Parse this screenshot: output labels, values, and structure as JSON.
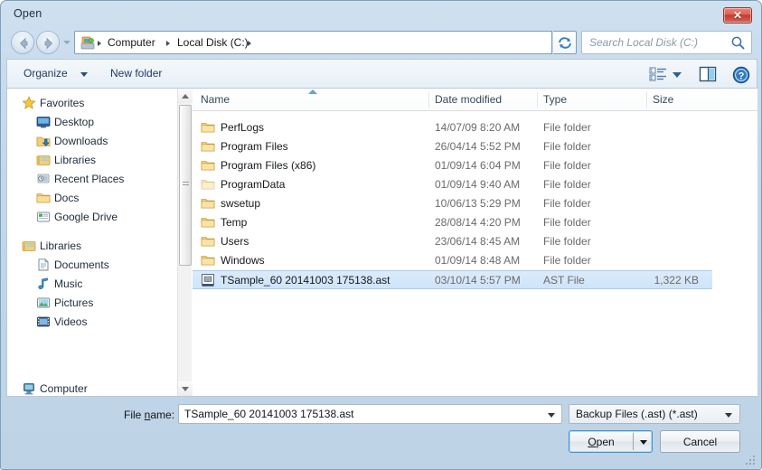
{
  "window": {
    "title": "Open",
    "close_label": "✕"
  },
  "navbar": {
    "back_icon": "back-arrow-icon",
    "forward_icon": "forward-arrow-icon",
    "history_icon": "history-dropdown-icon",
    "address_icon": "computer-icon",
    "breadcrumbs": [
      "Computer",
      "Local Disk (C:)"
    ],
    "address_dropdown_icon": "chevron-down-icon",
    "refresh_icon": "refresh-icon",
    "search_placeholder": "Search Local Disk (C:)",
    "search_value": "",
    "search_icon": "search-icon"
  },
  "commandbar": {
    "organize_label": "Organize",
    "organize_arrow_icon": "chevron-down-icon",
    "newfolder_label": "New folder",
    "viewmode_icon": "view-list-icon",
    "viewmode_arrow_icon": "chevron-down-icon",
    "preview_pane_icon": "preview-pane-icon",
    "help_icon": "help-icon"
  },
  "sidebar": {
    "groups": [
      {
        "header": {
          "label": "Favorites",
          "icon": "star-icon"
        },
        "items": [
          {
            "label": "Desktop",
            "icon": "desktop-icon"
          },
          {
            "label": "Downloads",
            "icon": "downloads-icon"
          },
          {
            "label": "Libraries",
            "icon": "libraries-icon"
          },
          {
            "label": "Recent Places",
            "icon": "recent-places-icon"
          },
          {
            "label": "Docs",
            "icon": "folder-icon"
          },
          {
            "label": "Google Drive",
            "icon": "google-drive-icon"
          }
        ]
      },
      {
        "header": {
          "label": "Libraries",
          "icon": "libraries-icon"
        },
        "items": [
          {
            "label": "Documents",
            "icon": "documents-icon"
          },
          {
            "label": "Music",
            "icon": "music-icon"
          },
          {
            "label": "Pictures",
            "icon": "pictures-icon"
          },
          {
            "label": "Videos",
            "icon": "videos-icon"
          }
        ]
      },
      {
        "header": {
          "label": "Computer",
          "icon": "computer-icon"
        },
        "items": []
      }
    ],
    "scrollbar": {
      "up_icon": "scroll-up-icon",
      "down_icon": "scroll-down-icon"
    }
  },
  "filelist": {
    "columns": [
      "Name",
      "Date modified",
      "Type",
      "Size"
    ],
    "sort_column": "Name",
    "sort_direction": "ascending",
    "rows": [
      {
        "name": "PerfLogs",
        "date": "14/07/09 8:20 AM",
        "type": "File folder",
        "size": "",
        "icon": "folder-icon",
        "selected": false
      },
      {
        "name": "Program Files",
        "date": "26/04/14 5:52 PM",
        "type": "File folder",
        "size": "",
        "icon": "folder-icon",
        "selected": false
      },
      {
        "name": "Program Files (x86)",
        "date": "01/09/14 6:04 PM",
        "type": "File folder",
        "size": "",
        "icon": "folder-icon",
        "selected": false
      },
      {
        "name": "ProgramData",
        "date": "01/09/14 9:40 AM",
        "type": "File folder",
        "size": "",
        "icon": "folder-faded-icon",
        "selected": false
      },
      {
        "name": "swsetup",
        "date": "10/06/13 5:29 PM",
        "type": "File folder",
        "size": "",
        "icon": "folder-icon",
        "selected": false
      },
      {
        "name": "Temp",
        "date": "28/08/14 4:20 PM",
        "type": "File folder",
        "size": "",
        "icon": "folder-icon",
        "selected": false
      },
      {
        "name": "Users",
        "date": "23/06/14 8:45 AM",
        "type": "File folder",
        "size": "",
        "icon": "folder-icon",
        "selected": false
      },
      {
        "name": "Windows",
        "date": "01/09/14 8:48 AM",
        "type": "File folder",
        "size": "",
        "icon": "folder-icon",
        "selected": false
      },
      {
        "name": "TSample_60 20141003 175138.ast",
        "date": "03/10/14 5:57 PM",
        "type": "AST File",
        "size": "1,322 KB",
        "icon": "ast-file-icon",
        "selected": true
      }
    ]
  },
  "footer": {
    "filename_label_prefix": "File ",
    "filename_label_accel": "n",
    "filename_label_suffix": "ame:",
    "filename_value": "TSample_60 20141003 175138.ast",
    "filename_dropdown_icon": "chevron-down-icon",
    "filter_value": "Backup Files (.ast) (*.ast)",
    "filter_dropdown_icon": "chevron-down-icon",
    "open_label_prefix": "",
    "open_label_accel": "O",
    "open_label_suffix": "pen",
    "open_split_icon": "chevron-down-icon",
    "cancel_label": "Cancel",
    "resize_grip_icon": "resize-grip-icon"
  },
  "colors": {
    "frame": "#bed3e6",
    "selection": "#cfe4fa",
    "selection_border": "#aacdf0",
    "default_button_border": "#3c93d4",
    "close_button": "#c4392d",
    "link_text": "#1b3a5c"
  }
}
